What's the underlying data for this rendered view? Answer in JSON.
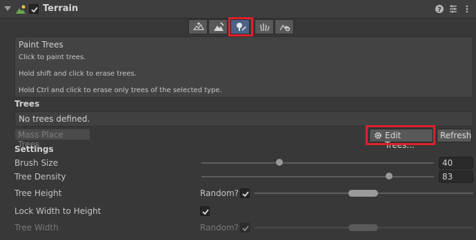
{
  "component": {
    "title": "Terrain",
    "enabled": true
  },
  "toolbar": {
    "tools": [
      {
        "icon": "raise-terrain-icon"
      },
      {
        "icon": "paint-texture-icon"
      },
      {
        "icon": "paint-trees-icon",
        "selected": true
      },
      {
        "icon": "paint-details-icon"
      },
      {
        "icon": "terrain-settings-icon"
      }
    ]
  },
  "help": {
    "title": "Paint Trees",
    "line1": "Click to paint trees.",
    "line2": "Hold shift and click to erase trees.",
    "line3": "Hold Ctrl and click to erase only trees of the selected type."
  },
  "trees": {
    "header": "Trees",
    "empty_text": "No trees defined.",
    "mass_place_label": "Mass Place Trees",
    "edit_label": "Edit Trees...",
    "refresh_label": "Refresh"
  },
  "settings": {
    "header": "Settings",
    "brush_size": {
      "label": "Brush Size",
      "value": "40"
    },
    "tree_density": {
      "label": "Tree Density",
      "value": "83"
    },
    "tree_height": {
      "label": "Tree Height",
      "random_label": "Random?",
      "random": true
    },
    "lock_width": {
      "label": "Lock Width to Height",
      "checked": true
    },
    "tree_width": {
      "label": "Tree Width",
      "random_label": "Random?",
      "random": true
    }
  },
  "colors": {
    "highlight": "#e0202c",
    "selected_tool": "#4b6386"
  }
}
